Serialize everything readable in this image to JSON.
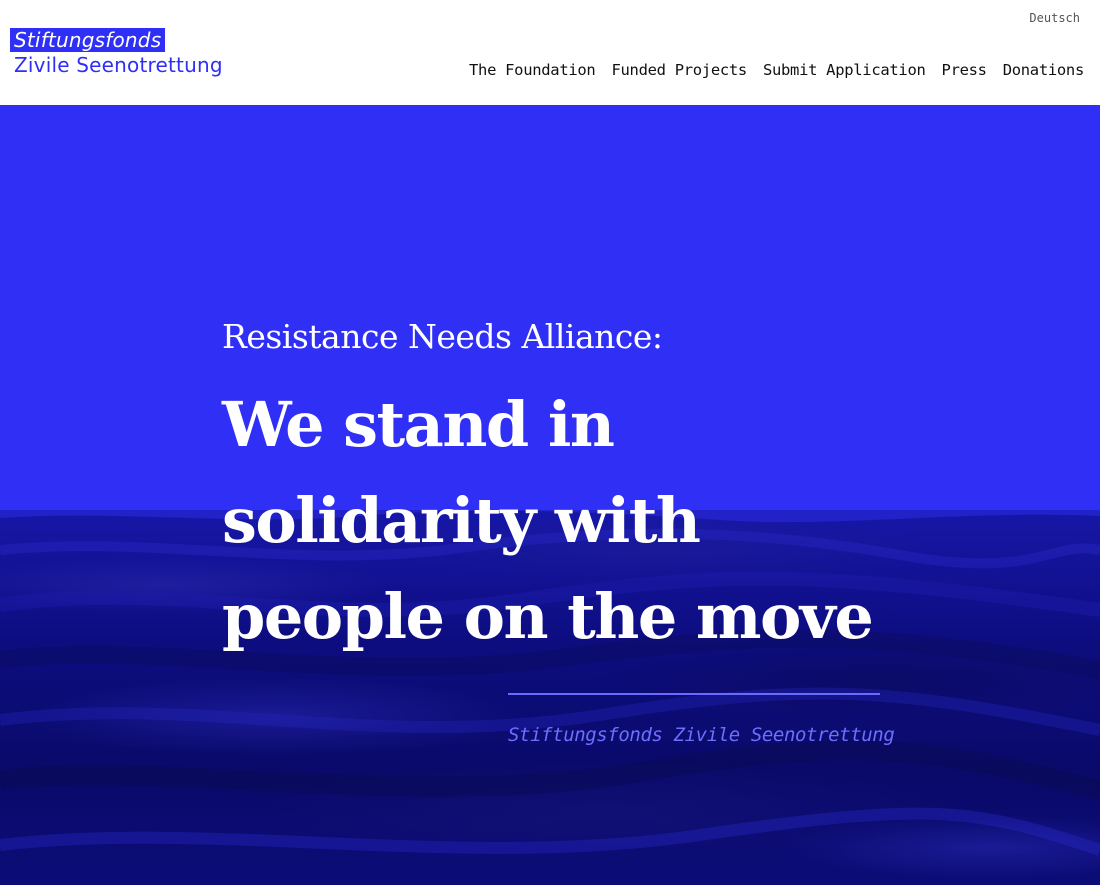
{
  "header": {
    "logo": {
      "line1": "Stiftungsfonds",
      "line2": "Zivile Seenotrettung"
    },
    "language_switch": "Deutsch",
    "nav": [
      {
        "label": "The Foundation"
      },
      {
        "label": "Funded Projects"
      },
      {
        "label": "Submit Application"
      },
      {
        "label": "Press"
      },
      {
        "label": "Donations"
      }
    ]
  },
  "hero": {
    "subtitle": "Resistance Needs Alliance:",
    "headline_lines": [
      "We stand in",
      "solidarity with",
      "people on the move"
    ],
    "signature": "Stiftungsfonds  Zivile  Seenotrettung"
  },
  "colors": {
    "brand_blue": "#2f2ff5",
    "sea_dark_blue": "#0d0d80",
    "signature_blue": "#6e6eff",
    "nav_text": "#111111",
    "headline_text": "#ffffff"
  }
}
